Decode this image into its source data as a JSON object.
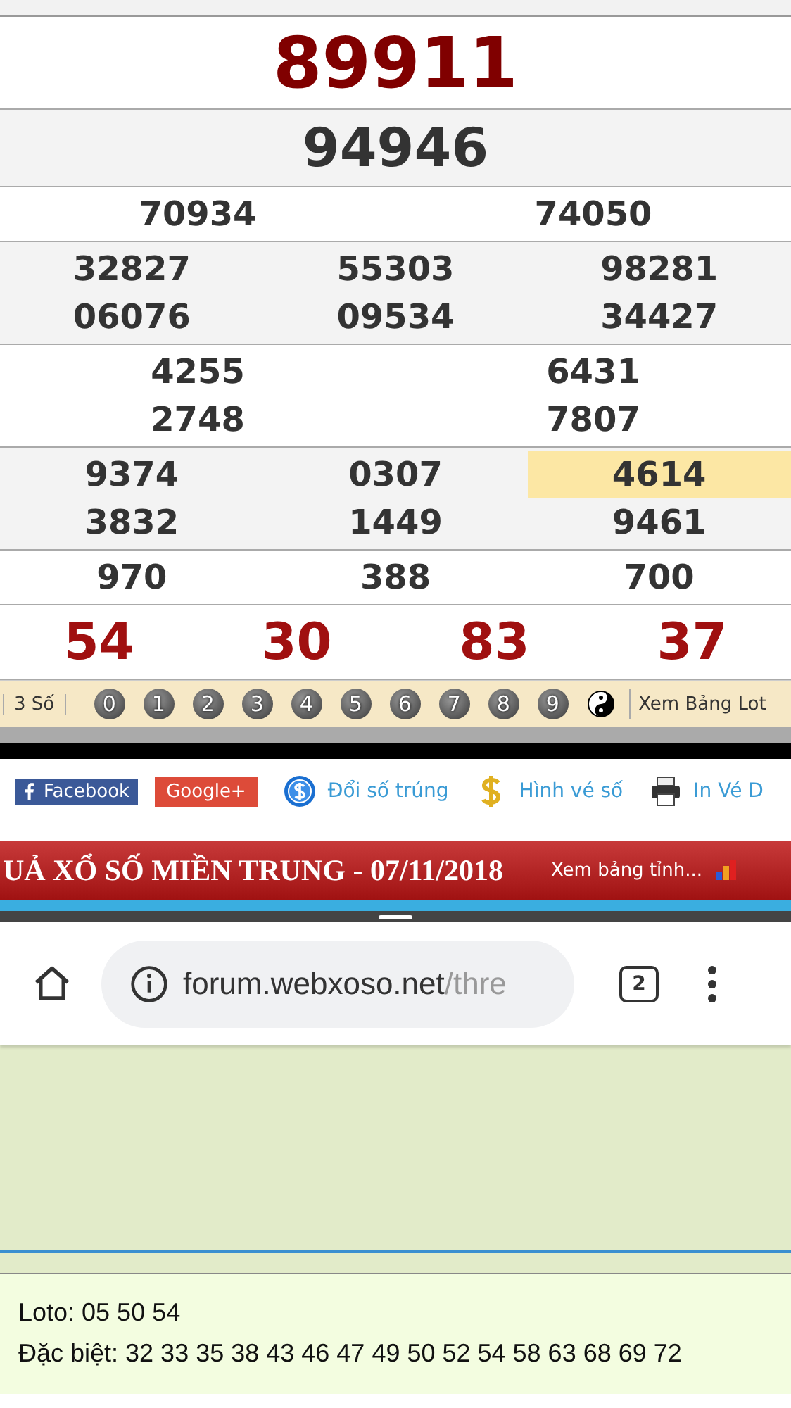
{
  "special_prize": "89911",
  "first_prize": "94946",
  "prizes": [
    {
      "columns": [
        [
          {
            "value": "70934",
            "selected": false
          }
        ],
        [
          {
            "value": "74050",
            "selected": false
          }
        ]
      ]
    },
    {
      "columns": [
        [
          {
            "value": "32827",
            "selected": false
          },
          {
            "value": "06076",
            "selected": false
          }
        ],
        [
          {
            "value": "55303",
            "selected": false
          },
          {
            "value": "09534",
            "selected": false
          }
        ],
        [
          {
            "value": "98281",
            "selected": false
          },
          {
            "value": "34427",
            "selected": false
          }
        ]
      ]
    },
    {
      "columns": [
        [
          {
            "value": "4255",
            "selected": false
          },
          {
            "value": "2748",
            "selected": false
          }
        ],
        [
          {
            "value": "6431",
            "selected": false
          },
          {
            "value": "7807",
            "selected": false
          }
        ]
      ]
    },
    {
      "columns": [
        [
          {
            "value": "9374",
            "selected": false
          },
          {
            "value": "3832",
            "selected": false
          }
        ],
        [
          {
            "value": "0307",
            "selected": false
          },
          {
            "value": "1449",
            "selected": false
          }
        ],
        [
          {
            "value": "4614",
            "selected": true
          },
          {
            "value": "9461",
            "selected": false
          }
        ]
      ]
    },
    {
      "columns": [
        [
          {
            "value": "970",
            "selected": false
          }
        ],
        [
          {
            "value": "388",
            "selected": false
          }
        ],
        [
          {
            "value": "700",
            "selected": false
          }
        ]
      ]
    }
  ],
  "eighth_prize": [
    "54",
    "30",
    "83",
    "37"
  ],
  "toolbar": {
    "label": "3 Số",
    "digits": [
      "0",
      "1",
      "2",
      "3",
      "4",
      "5",
      "6",
      "7",
      "8",
      "9"
    ],
    "link": "Xem Bảng Lot"
  },
  "social": {
    "facebook": "Facebook",
    "google": "Google+",
    "links": [
      {
        "kind": "coin",
        "label": "Đổi số trúng"
      },
      {
        "kind": "dollar",
        "label": "Hình vé số"
      },
      {
        "kind": "printer",
        "label": "In Vé D"
      }
    ]
  },
  "banner": {
    "title": "UẢ XỔ SỐ MIỀN TRUNG - 07/11/2018",
    "link": "Xem bảng tỉnh..."
  },
  "browser": {
    "url_host": "forum.webxoso.net",
    "url_path": "/thre",
    "tab_count": "2"
  },
  "post": {
    "lines": [
      "Loto: 05 50 54",
      "Đặc biệt: 32 33 35 38 43 46 47 49 50 52 54 58 63 68 69 72"
    ]
  }
}
